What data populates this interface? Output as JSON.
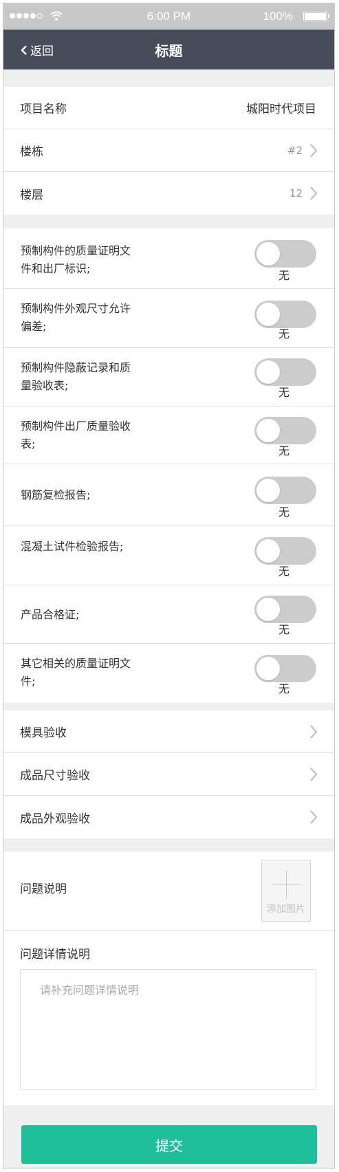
{
  "status_bar": {
    "time": "6:00 PM",
    "battery": "100%"
  },
  "nav": {
    "back_label": "返回",
    "title": "标题"
  },
  "info": {
    "project_label": "项目名称",
    "project_value": "城阳时代项目",
    "building_label": "楼栋",
    "building_value": "#2",
    "floor_label": "楼层",
    "floor_value": "12"
  },
  "checks": [
    {
      "label": "预制构件的质量证明文件和出厂标识;",
      "state": "无",
      "on": false
    },
    {
      "label": "预制构件外观尺寸允许偏差;",
      "state": "无",
      "on": false
    },
    {
      "label": "预制构件隐蔽记录和质量验收表;",
      "state": "无",
      "on": false
    },
    {
      "label": "预制构件出厂质量验收表;",
      "state": "无",
      "on": false
    },
    {
      "label": "钢筋复检报告;",
      "state": "无",
      "on": false
    },
    {
      "label": "混凝土试件检验报告;",
      "state": "无",
      "on": false
    },
    {
      "label": "产品合格证;",
      "state": "无",
      "on": false
    },
    {
      "label": "其它相关的质量证明文件;",
      "state": "无",
      "on": false
    }
  ],
  "inspections": {
    "mold": "模具验收",
    "size": "成品尺寸验收",
    "appearance": "成品外观验收"
  },
  "problem": {
    "label": "问题说明",
    "add_photo": "添加图片",
    "detail_label": "问题详情说明",
    "detail_placeholder": "请补充问题详情说明"
  },
  "submit_label": "提交",
  "colors": {
    "nav_bg": "#474c5a",
    "accent": "#1dc09b",
    "toggle_off": "#cccccc"
  }
}
